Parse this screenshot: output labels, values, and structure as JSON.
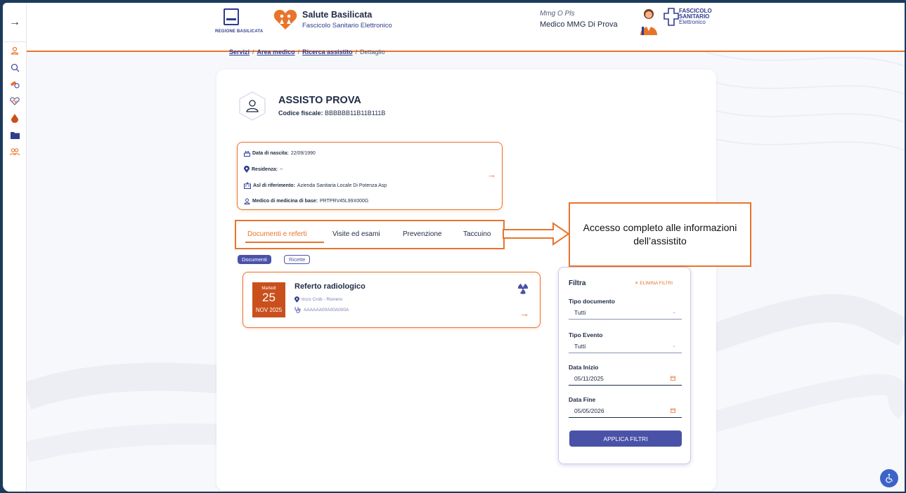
{
  "header": {
    "region_label": "REGIONE BASILICATA",
    "app_title": "Salute Basilicata",
    "app_subtitle": "Fascicolo Sanitario Elettronico",
    "user_role": "Mmg O Pls",
    "user_name": "Medico MMG Di Prova",
    "fse_logo_line1": "FASCICOLO",
    "fse_logo_line2": "SANITARIO",
    "fse_logo_line3": "Elettronico"
  },
  "sidebar": {
    "toggle_glyph": "→",
    "icons": [
      "user-icon",
      "search-icon",
      "pills-icon",
      "heart-pulse-icon",
      "blood-drop-icon",
      "folder-icon",
      "users-icon"
    ]
  },
  "breadcrumb": {
    "items": [
      "Servizi",
      "Area medico",
      "Ricerca assistito"
    ],
    "current": "Dettaglio",
    "separator": "/"
  },
  "patient": {
    "name": "ASSISTO PROVA",
    "cf_label": "Codice fiscale:",
    "cf_value": "BBBBBB11B11B111B"
  },
  "info": {
    "birth_label": "Data di nascita:",
    "birth_value": "22/09/1990",
    "residence_label": "Residenza:",
    "residence_value": "--",
    "asl_label": "Asl di riferimento:",
    "asl_value": "Azienda Sanitaria Locale Di Potenza Asp",
    "doctor_label": "Medico di medicina di base:",
    "doctor_value": "PRTPRV45L99X000G",
    "arrow": "→"
  },
  "tabs": [
    {
      "label": "Documenti e referti",
      "active": true
    },
    {
      "label": "Visite ed esami",
      "active": false
    },
    {
      "label": "Prevenzione",
      "active": false
    },
    {
      "label": "Taccuino",
      "active": false
    }
  ],
  "callout": {
    "text": "Accesso completo alle informazioni dell’assistito"
  },
  "pills": {
    "documents": "Documenti",
    "prescriptions": "Ricette"
  },
  "document": {
    "day_name": "Martedì",
    "day_num": "25",
    "month_year": "NOV 2025",
    "title": "Referto radiologico",
    "location": "Irccs Crob - Rionero",
    "code": "AAAAAA00A00A000A",
    "arrow": "→"
  },
  "filter": {
    "title": "Filtra",
    "clear_label": "ELIMINA FILTRI",
    "doc_type_label": "Tipo documento",
    "doc_type_value": "Tutti",
    "event_type_label": "Tipo Evento",
    "event_type_value": "Tutti",
    "start_label": "Data Inizio",
    "start_value": "05/11/2025",
    "end_label": "Data Fine",
    "end_value": "05/05/2026",
    "apply_label": "APPLICA FILTRI"
  },
  "colors": {
    "accent": "#e8742c",
    "primary": "#4a52a8",
    "date_tile": "#c9501c",
    "text": "#1e2a44"
  }
}
